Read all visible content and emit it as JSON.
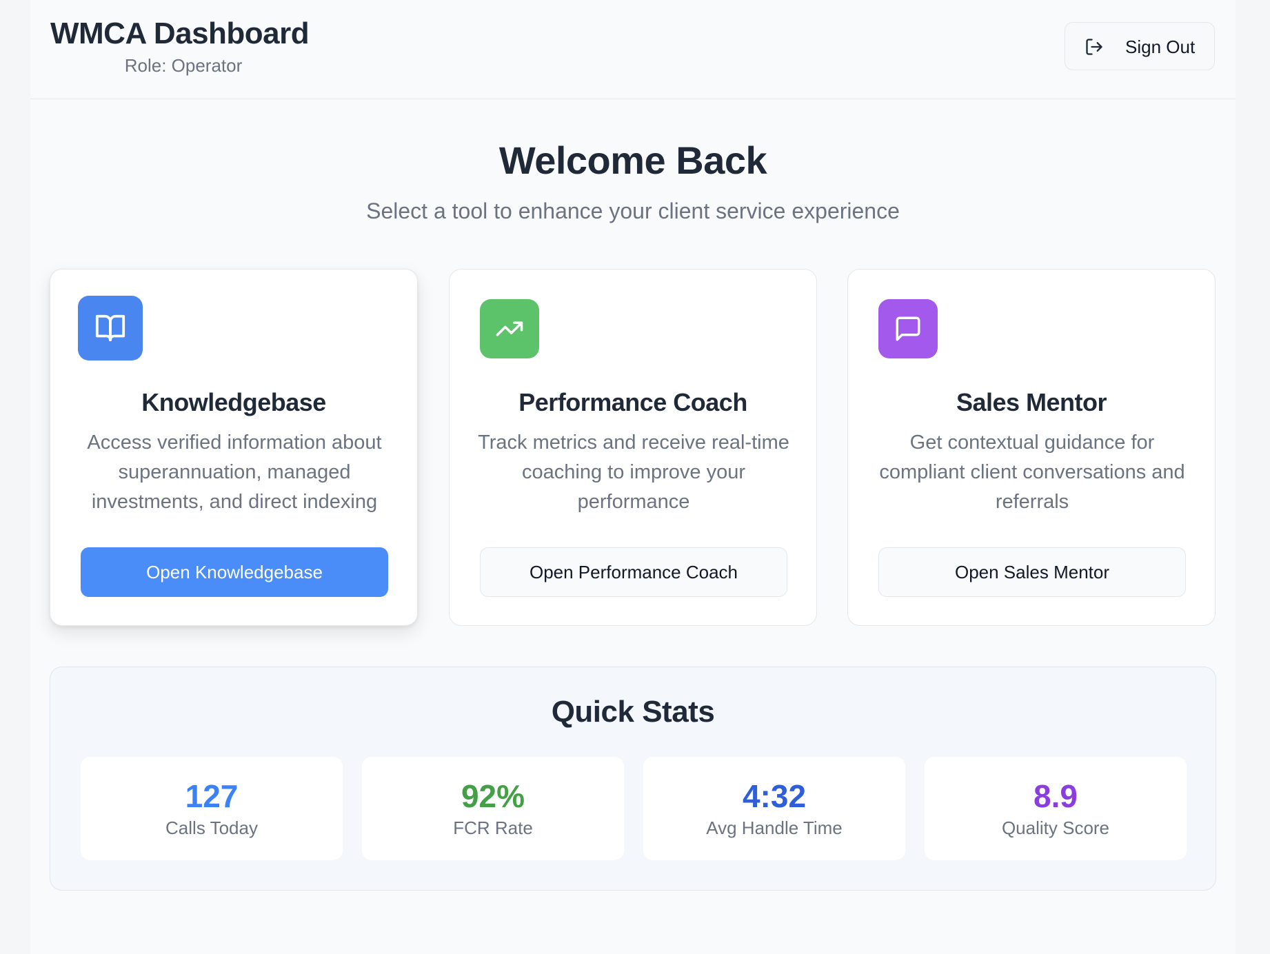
{
  "header": {
    "title": "WMCA Dashboard",
    "role": "Role: Operator",
    "signout_label": "Sign Out",
    "signout_icon": "sign-out-icon"
  },
  "hero": {
    "title": "Welcome Back",
    "subtitle": "Select a tool to enhance your client service experience"
  },
  "tools": [
    {
      "title": "Knowledgebase",
      "description": "Access verified information about superannuation, managed investments, and direct indexing",
      "button_label": "Open Knowledgebase",
      "icon": "book-open-icon",
      "color": "#4a86f0"
    },
    {
      "title": "Performance Coach",
      "description": "Track metrics and receive real-time coaching to improve your performance",
      "button_label": "Open Performance Coach",
      "icon": "trending-up-icon",
      "color": "#5cc36a"
    },
    {
      "title": "Sales Mentor",
      "description": "Get contextual guidance for compliant client conversations and referrals",
      "button_label": "Open Sales Mentor",
      "icon": "message-square-icon",
      "color": "#a259ec"
    }
  ],
  "quick_stats": {
    "title": "Quick Stats",
    "items": [
      {
        "value": "127",
        "label": "Calls Today",
        "color": "#3b82f6"
      },
      {
        "value": "92%",
        "label": "FCR Rate",
        "color": "#43a047"
      },
      {
        "value": "4:32",
        "label": "Avg Handle Time",
        "color": "#2f5fd8"
      },
      {
        "value": "8.9",
        "label": "Quality Score",
        "color": "#8a3ee0"
      }
    ]
  }
}
